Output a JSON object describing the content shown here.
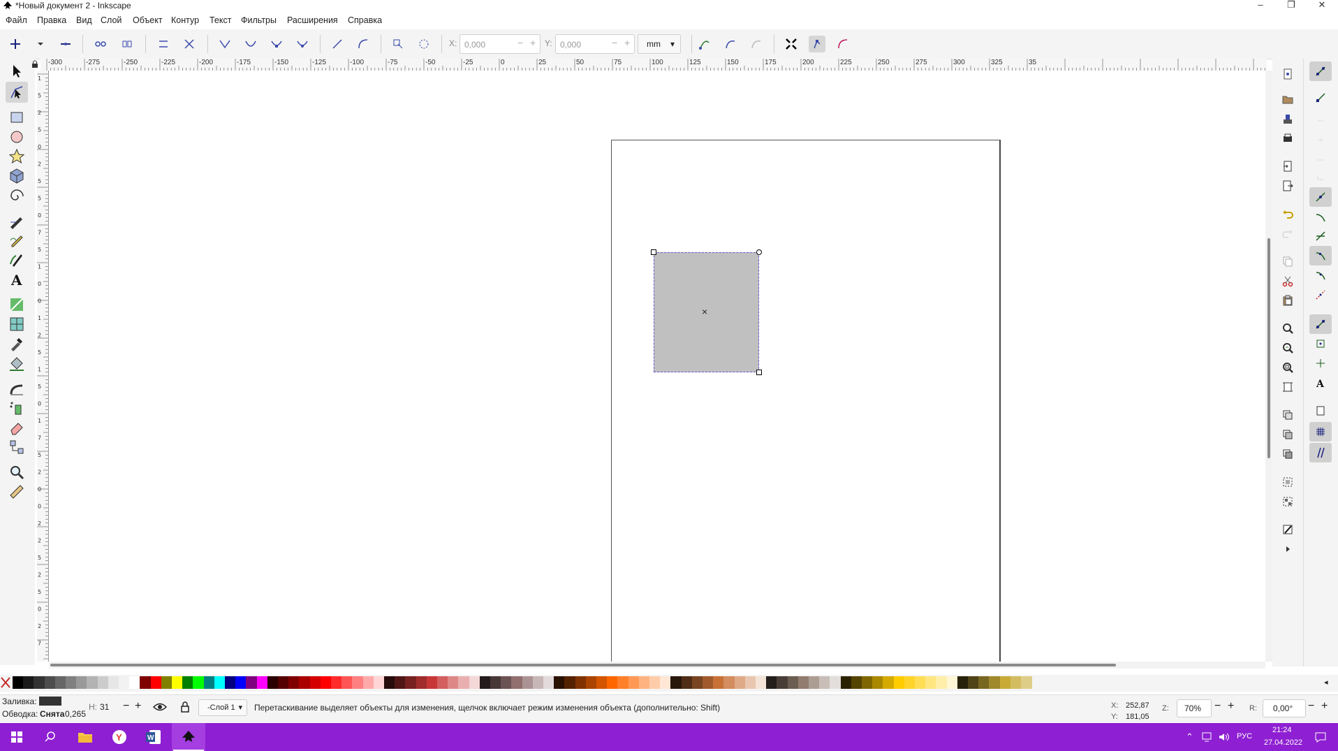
{
  "window": {
    "title": "*Новый документ 2 - Inkscape",
    "minimize": "–",
    "restore": "❐",
    "close": "✕"
  },
  "menu": [
    "Файл",
    "Правка",
    "Вид",
    "Слой",
    "Объект",
    "Контур",
    "Текст",
    "Фильтры",
    "Расширения",
    "Справка"
  ],
  "tool_controls": {
    "x_label": "X:",
    "x_value": "0,000",
    "y_label": "Y:",
    "y_value": "0,000",
    "unit": "mm"
  },
  "ruler": {
    "h_labels": [
      "-300",
      "-275",
      "-250",
      "-225",
      "-200",
      "-175",
      "-150",
      "-125",
      "-100",
      "-75",
      "-50",
      "-25",
      "0",
      "25",
      "50",
      "75",
      "100",
      "125",
      "150",
      "175",
      "200",
      "225",
      "250",
      "275",
      "300",
      "325",
      "35"
    ],
    "v_labels": [
      "1",
      "5",
      "2",
      "5",
      "0",
      "2",
      "5",
      "5",
      "0",
      "7",
      "5",
      "1",
      "0",
      "0",
      "1",
      "2",
      "5",
      "1",
      "5",
      "0",
      "1",
      "7",
      "5",
      "2",
      "0",
      "0",
      "2",
      "2",
      "5",
      "2",
      "5",
      "0",
      "2",
      "7"
    ]
  },
  "tools": [
    "selector-tool",
    "node-tool",
    "rect-tool",
    "ellipse-tool",
    "star-tool",
    "3dbox-tool",
    "spiral-tool",
    "pen-tool",
    "pencil-tool",
    "calligraphy-tool",
    "text-tool",
    "gradient-tool",
    "mesh-tool",
    "dropper-tool",
    "paint-bucket-tool",
    "tweak-tool",
    "spray-tool",
    "eraser-tool",
    "connector-tool",
    "zoom-tool",
    "measure-tool"
  ],
  "palette": [
    "#000000",
    "#1a1a1a",
    "#333333",
    "#4d4d4d",
    "#666666",
    "#808080",
    "#999999",
    "#b3b3b3",
    "#cccccc",
    "#e6e6e6",
    "#f2f2f2",
    "#ffffff",
    "#800000",
    "#ff0000",
    "#808000",
    "#ffff00",
    "#008000",
    "#00ff00",
    "#008080",
    "#00ffff",
    "#000080",
    "#0000ff",
    "#800080",
    "#ff00ff",
    "#2b0000",
    "#550000",
    "#800000",
    "#aa0000",
    "#d40000",
    "#ff0000",
    "#ff2a2a",
    "#ff5555",
    "#ff8080",
    "#ffaaaa",
    "#ffd5d5",
    "#280b0b",
    "#501616",
    "#782121",
    "#a02c2c",
    "#c83737",
    "#d35f5f",
    "#de8787",
    "#e9afaf",
    "#f4d7d7",
    "#241c1c",
    "#483737",
    "#6c5353",
    "#916f6f",
    "#ac9393",
    "#c8b7b7",
    "#e3dbdb",
    "#2b1100",
    "#552200",
    "#803300",
    "#aa4400",
    "#d45500",
    "#ff6600",
    "#ff7f2a",
    "#ff9955",
    "#ffb380",
    "#ffccaa",
    "#ffe6d5",
    "#28170b",
    "#502d16",
    "#784421",
    "#a05a2c",
    "#c87137",
    "#d38d5f",
    "#deaa87",
    "#e9c6af",
    "#f4e3d7",
    "#241f1c",
    "#483e37",
    "#6c5d53",
    "#917c6f",
    "#ac9d93",
    "#c8beb7",
    "#e3dedb",
    "#2b2200",
    "#554400",
    "#806600",
    "#aa8800",
    "#d4aa00",
    "#ffcc00",
    "#ffd42a",
    "#ffdd55",
    "#ffe680",
    "#ffeeaa",
    "#fff6d5",
    "#28220b",
    "#504416",
    "#786721",
    "#a0892c",
    "#c8ab37",
    "#d3bc5f",
    "#decd87"
  ],
  "status": {
    "fill_label": "Заливка:",
    "fill_color": "#333333",
    "stroke_label": "Обводка:",
    "stroke_value": "Снята",
    "stroke_width": "0,265",
    "h_label": "Н:",
    "h_value": "31",
    "layer": "-Слой 1",
    "message": "Перетаскивание выделяет объекты для изменения, щелчок включает режим изменения объекта (дополнительно: Shift)",
    "x_label": "X:",
    "x_value": "252,87",
    "y_label": "Y:",
    "y_value": "181,05",
    "zoom_label": "Z:",
    "zoom_value": "70%",
    "rot_label": "R:",
    "rot_value": "0,00°"
  },
  "taskbar": {
    "lang": "РУС",
    "time": "21:24",
    "date": "27.04.2022",
    "background": "#8e1fd2"
  }
}
